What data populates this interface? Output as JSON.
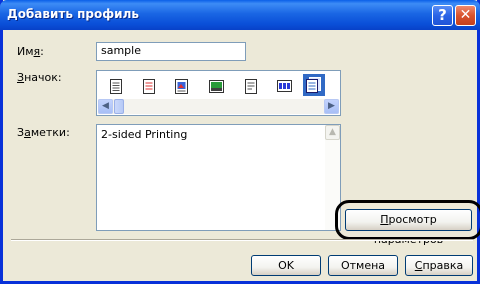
{
  "dialog": {
    "title": "Добавить профиль"
  },
  "form": {
    "name_label_pre": "Им",
    "name_label_ul": "я",
    "name_label_post": ":",
    "name_value": "sample",
    "icon_label_ul": "З",
    "icon_label_post": "начок:",
    "notes_label_pre": "З",
    "notes_label_ul": "а",
    "notes_label_post": "метки:",
    "notes_value": "2-sided Printing"
  },
  "icons": [
    "document-icon",
    "color-document-icon",
    "photo-document-icon",
    "image-icon",
    "booklet-icon",
    "layout-icon",
    "duplex-icon"
  ],
  "buttons": {
    "view_settings_ul": "П",
    "view_settings_post": "росмотр параметров",
    "ok": "OK",
    "cancel": "Отмена",
    "help_ul": "С",
    "help_post": "правка"
  },
  "colors": {
    "title_bar": "#0a4fd8",
    "selection": "#316ac5",
    "dialog_bg": "#ece9d8"
  }
}
